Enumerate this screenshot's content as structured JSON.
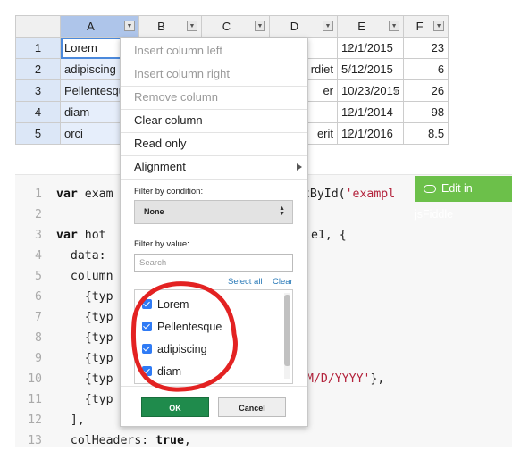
{
  "grid": {
    "columns": [
      "A",
      "B",
      "C",
      "D",
      "E",
      "F"
    ],
    "row_numbers": [
      "1",
      "2",
      "3",
      "4",
      "5"
    ],
    "col_a": [
      "Lorem",
      "adipiscing",
      "Pellentesque",
      "diam",
      "orci"
    ],
    "col_d_partial": [
      "",
      "rdiet",
      "er",
      "",
      "erit"
    ],
    "col_e": [
      "12/1/2015",
      "5/12/2015",
      "10/23/2015",
      "12/1/2014",
      "12/1/2016"
    ],
    "col_f": [
      "23",
      "6",
      "26",
      "98",
      "8.5"
    ],
    "column_menu_icon": "dropdown-arrow-icon",
    "selection_color": "#4b89dc"
  },
  "code": {
    "line_numbers": [
      "1",
      "2",
      "3",
      "4",
      "5",
      "6",
      "7",
      "8",
      "9",
      "10",
      "11",
      "12",
      "13"
    ],
    "lines": [
      {
        "kw": "var",
        "text": " exam",
        "text2": "ntById(",
        "str": "'exampl"
      },
      {
        "kw": "",
        "text": ""
      },
      {
        "kw": "var",
        "text": " hot",
        "text2": "le1, {"
      },
      {
        "kw": "",
        "text": "  data: "
      },
      {
        "kw": "",
        "text": "  column"
      },
      {
        "kw": "",
        "text": "    {typ"
      },
      {
        "kw": "",
        "text": "    {typ"
      },
      {
        "kw": "",
        "text": "    {typ"
      },
      {
        "kw": "",
        "text": "    {typ"
      },
      {
        "kw": "",
        "text": "    {typ",
        "str": "M/D/YYYY'",
        "text2": "},"
      },
      {
        "kw": "",
        "text": "    {typ"
      },
      {
        "kw": "",
        "text": "  ],"
      },
      {
        "kw": "",
        "text": "  colHeaders: ",
        "kw2": "true",
        "text2": ","
      }
    ],
    "jsfiddle_label": "Edit in jsFiddle",
    "jsfiddle_icon": "cloud-icon",
    "jsfiddle_color": "#6cc04a"
  },
  "menu": {
    "items": [
      {
        "label": "Insert column left",
        "disabled": true
      },
      {
        "label": "Insert column right",
        "disabled": true
      },
      {
        "label": "Remove column",
        "disabled": true
      },
      {
        "label": "Clear column",
        "disabled": false
      },
      {
        "label": "Read only",
        "disabled": false
      },
      {
        "label": "Alignment",
        "disabled": false,
        "submenu": true
      }
    ],
    "filter_condition_label": "Filter by condition:",
    "condition_value": "None",
    "filter_value_label": "Filter by value:",
    "search_placeholder": "Search",
    "select_all": "Select all",
    "clear": "Clear",
    "values": [
      {
        "label": "Lorem",
        "checked": true
      },
      {
        "label": "Pellentesque",
        "checked": true
      },
      {
        "label": "adipiscing",
        "checked": true
      },
      {
        "label": "diam",
        "checked": true
      }
    ],
    "ok_label": "OK",
    "cancel_label": "Cancel",
    "ok_color": "#1f8b4c"
  },
  "annotation_color": "#e32222"
}
